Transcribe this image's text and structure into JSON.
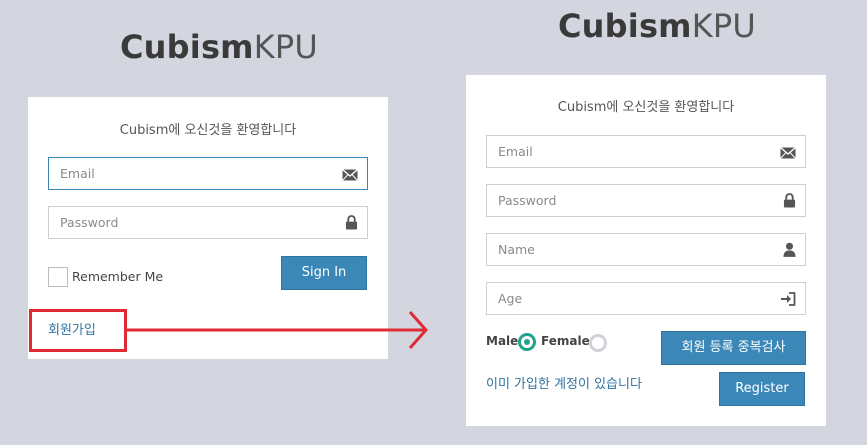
{
  "left": {
    "brand_bold": "Cubism",
    "brand_thin": "KPU",
    "welcome": "Cubism에 오신것을 환영합니다",
    "email_placeholder": "Email",
    "password_placeholder": "Password",
    "remember_label": "Remember Me",
    "signin_label": "Sign In",
    "signup_link": "회원가입"
  },
  "right": {
    "brand_bold": "Cubism",
    "brand_thin": "KPU",
    "welcome": "Cubism에 오신것을 환영합니다",
    "email_placeholder": "Email",
    "password_placeholder": "Password",
    "name_placeholder": "Name",
    "age_placeholder": "Age",
    "gender_male": "Male",
    "gender_female": "Female",
    "gender_selected": "Male",
    "dup_check_label": "회원 등록 중복검사",
    "have_account_link": "이미 가입한 계정이 있습니다",
    "register_label": "Register"
  },
  "annotation_color": "#e02b36",
  "accent_color": "#3a87b8"
}
